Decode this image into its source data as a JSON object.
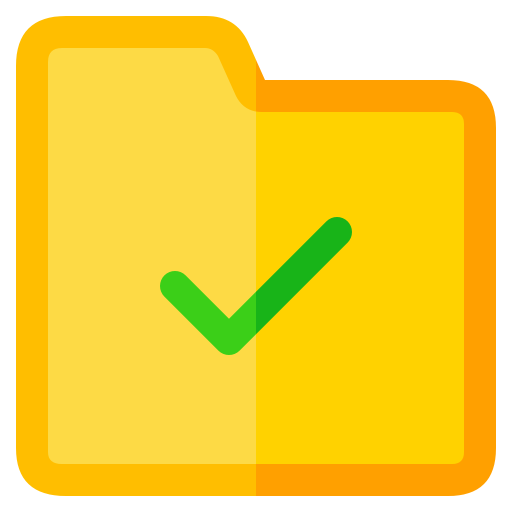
{
  "icon": {
    "name": "folder-check-icon",
    "colors": {
      "folder_outline_left": "#FFBE00",
      "folder_outline_right": "#FFA000",
      "folder_fill_left": "#FDDA45",
      "folder_fill_right": "#FFD200",
      "check_left": "#3BCF18",
      "check_right": "#18B418"
    }
  }
}
